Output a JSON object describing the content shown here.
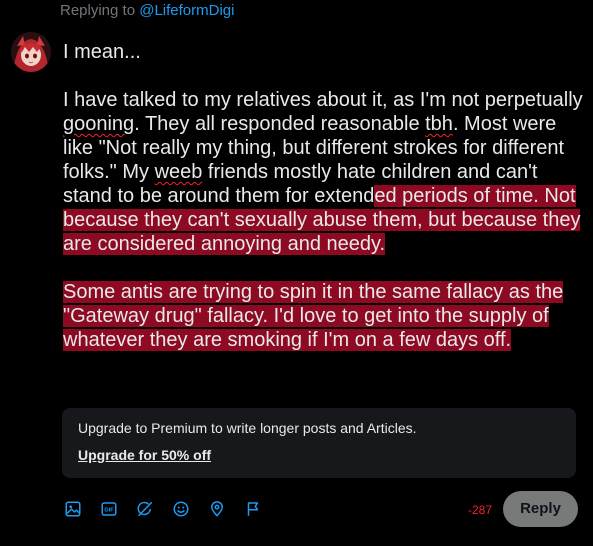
{
  "reply_context": {
    "prefix": "Replying to",
    "handle": "@LifeformDigi"
  },
  "post": {
    "line1": "I mean...",
    "p1_a": "I have talked to my relatives about it, as I'm not perpetually ",
    "p1_gooning": "gooning",
    "p1_b": ". They all responded reasonable ",
    "p1_tbh": "tbh",
    "p1_c": ". Most were like \"Not really my thing, but different strokes for different folks.\" My ",
    "p1_weeb": "weeb",
    "p1_d": " friends mostly hate children and can't stand to be around them for extend",
    "p1_highlight": "ed periods of time. Not because they can't sexually abuse them, but because they are considered annoying and needy.",
    "p2_highlight": "Some antis are trying to spin it in the same fallacy as the \"Gateway drug\" fallacy. I'd love to get into the supply of whatever they are smoking if I'm on a few days off."
  },
  "upsell": {
    "message": "Upgrade to Premium to write longer posts and Articles.",
    "cta": "Upgrade for 50% off"
  },
  "toolbar": {
    "icons": [
      "image-icon",
      "gif-icon",
      "grok-icon",
      "emoji-icon",
      "location-icon",
      "flag-icon"
    ],
    "accent": "#1d9bf0"
  },
  "composer": {
    "char_counter": "-287",
    "reply_label": "Reply"
  },
  "colors": {
    "background": "#000000",
    "text": "#e7e9ea",
    "muted": "#71767b",
    "link": "#1d9bf0",
    "highlight": "#8d0a22",
    "error": "#f4212e"
  }
}
